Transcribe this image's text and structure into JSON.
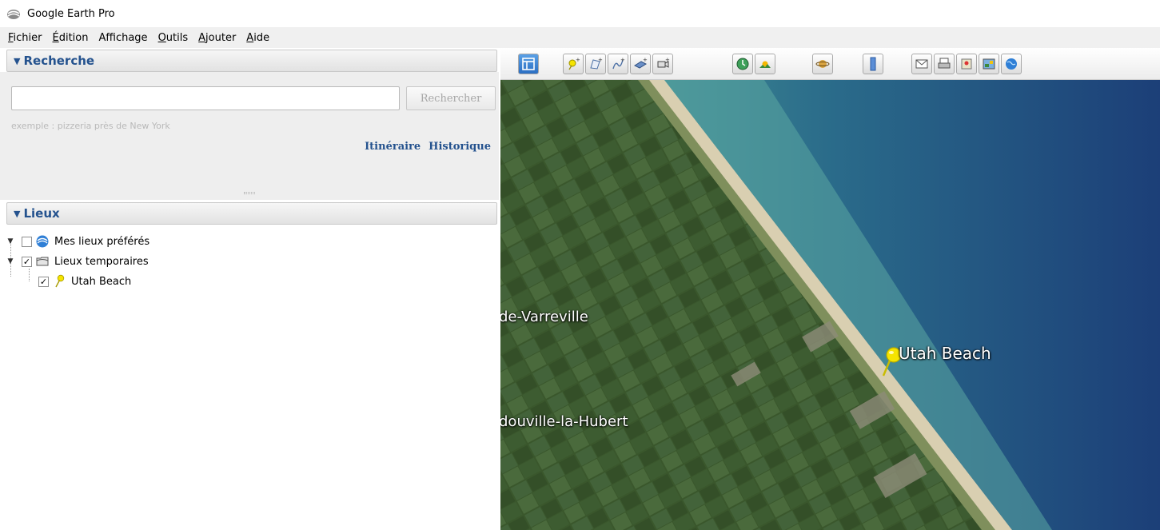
{
  "window": {
    "title": "Google Earth Pro"
  },
  "menubar": {
    "items": [
      {
        "mnemonic": "F",
        "rest": "ichier"
      },
      {
        "mnemonic": "É",
        "rest": "dition"
      },
      {
        "mnemonic": "",
        "rest": "Affichage"
      },
      {
        "mnemonic": "O",
        "rest": "utils"
      },
      {
        "mnemonic": "A",
        "rest": "jouter"
      },
      {
        "mnemonic": "A",
        "rest": "ide"
      }
    ]
  },
  "search": {
    "header": "Recherche",
    "input_value": "",
    "button_label": "Rechercher",
    "hint": "exemple : pizzeria près de New York",
    "links": [
      "Itinéraire",
      "Historique"
    ]
  },
  "places": {
    "header": "Lieux",
    "items": [
      {
        "label": "Mes lieux préférés",
        "checked": false,
        "icon": "earth-icon"
      },
      {
        "label": "Lieux temporaires",
        "checked": true,
        "icon": "folder-icon"
      },
      {
        "label": "Utah Beach",
        "checked": true,
        "icon": "pushpin-icon"
      }
    ]
  },
  "toolbar": {
    "buttons": [
      "sidebar-toggle-icon",
      "add-placemark-icon",
      "add-polygon-icon",
      "add-path-icon",
      "add-image-overlay-icon",
      "record-tour-icon",
      "historical-imagery-icon",
      "sunlight-icon",
      "planets-icon",
      "ruler-icon",
      "email-icon",
      "print-icon",
      "google-maps-icon",
      "save-image-icon",
      "earth-view-icon"
    ]
  },
  "map": {
    "labels": {
      "town_1": "de-Varreville",
      "town_2": "douville-la-Hubert"
    },
    "placemark_label": "Utah Beach",
    "colors": {
      "land": "#39562c",
      "sea": "#1f4a7a",
      "beach": "#d9cfb1",
      "pin": "#f5e400"
    }
  }
}
